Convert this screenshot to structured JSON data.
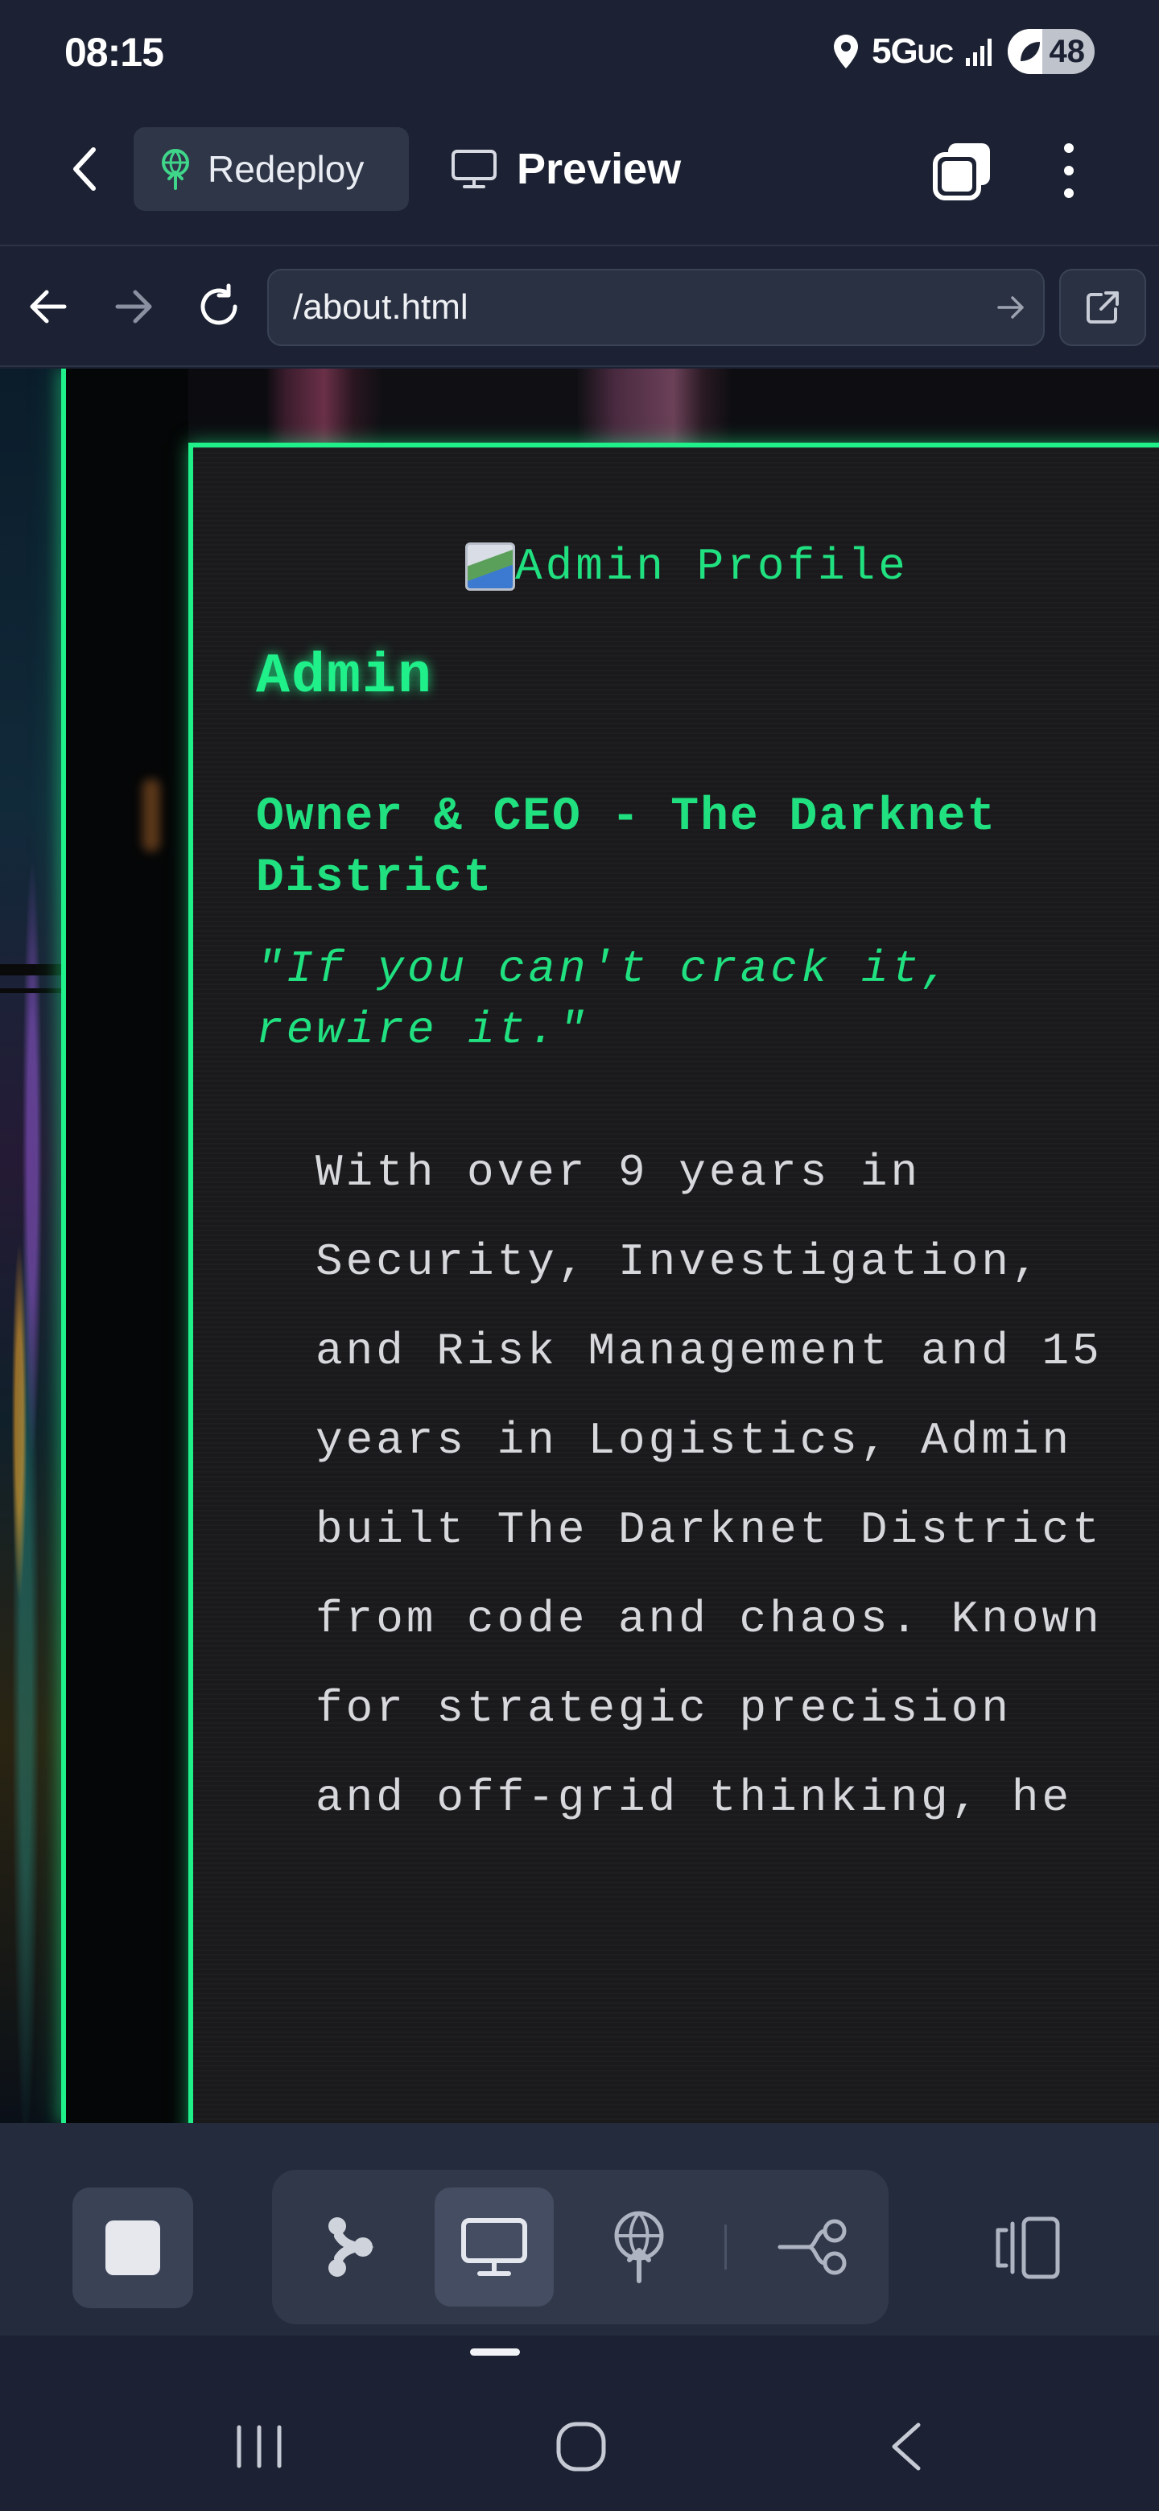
{
  "status_bar": {
    "time": "08:15",
    "network": "5G",
    "network_suffix": "UC",
    "battery": "48",
    "icons": [
      "location-icon",
      "signal-icon",
      "battery-icon"
    ]
  },
  "toolbar": {
    "redeploy_label": "Redeploy",
    "preview_label": "Preview",
    "icons": [
      "back-icon",
      "redeploy-icon",
      "monitor-icon",
      "tabs-icon",
      "more-icon"
    ]
  },
  "url_bar": {
    "url": "/about.html",
    "icons": [
      "nav-back-icon",
      "nav-forward-icon",
      "reload-icon",
      "go-icon",
      "external-link-icon"
    ]
  },
  "page": {
    "image_alt": "Admin Profile",
    "name": "Admin",
    "title": "Owner & CEO - The Darknet District",
    "quote": "\"If you can't crack it, rewire it.\"",
    "bio": "With over 9 years in Security, Investigation, and Risk Management and 15 years in Logistics, Admin built The Darknet District from code and chaos. Known for strategic precision and off-grid thinking, he",
    "accent_color": "#20f08a"
  },
  "bottom_toolbar": {
    "icons": [
      "stop-icon",
      "agent-icon",
      "preview-icon",
      "deploy-icon",
      "git-icon",
      "panel-icon"
    ],
    "active": "preview-icon"
  },
  "nav_bar": {
    "icons": [
      "recents-icon",
      "home-icon",
      "back-icon"
    ]
  }
}
